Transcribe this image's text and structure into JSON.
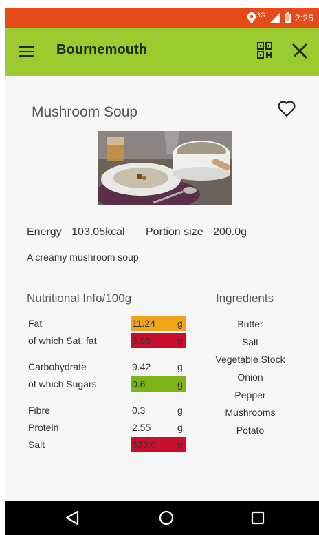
{
  "status_bar": {
    "time": "2:25",
    "network": "3G"
  },
  "app_bar": {
    "title": "Bournemouth",
    "icons": [
      "menu-icon",
      "qr-code-icon",
      "cutlery-icon"
    ]
  },
  "recipe": {
    "title": "Mushroom Soup",
    "energy_label": "Energy",
    "energy_value": "103.05kcal",
    "portion_label": "Portion size",
    "portion_value": "200.0g",
    "description": "A creamy mushroom soup"
  },
  "nutrition": {
    "header": "Nutritional Info/100g",
    "rows": [
      {
        "label": "Fat",
        "value": "11.24",
        "unit": "g",
        "color": "#f2a51a"
      },
      {
        "label": "of which Sat. fat",
        "value": "5.85",
        "unit": "g",
        "color": "#c8102e"
      },
      {
        "label": "Carbohydrate",
        "value": "9.42",
        "unit": "g",
        "color": ""
      },
      {
        "label": "of which Sugars",
        "value": "0.6",
        "unit": "g",
        "color": "#7cb518"
      },
      {
        "label": "Fibre",
        "value": "0.3",
        "unit": "g",
        "color": ""
      },
      {
        "label": "Protein",
        "value": "2.55",
        "unit": "g",
        "color": ""
      },
      {
        "label": "Salt",
        "value": "633.0",
        "unit": "g",
        "color": "#c8102e"
      }
    ]
  },
  "ingredients": {
    "header": "Ingredients",
    "items": [
      "Butter",
      "Salt",
      "Vegetable Stock",
      "Onion",
      "Pepper",
      "Mushrooms",
      "Potato"
    ]
  },
  "colors": {
    "status_bar": "#e64a19",
    "app_bar": "#9ccb2f",
    "amber": "#f2a51a",
    "red": "#c8102e",
    "green": "#7cb518"
  }
}
